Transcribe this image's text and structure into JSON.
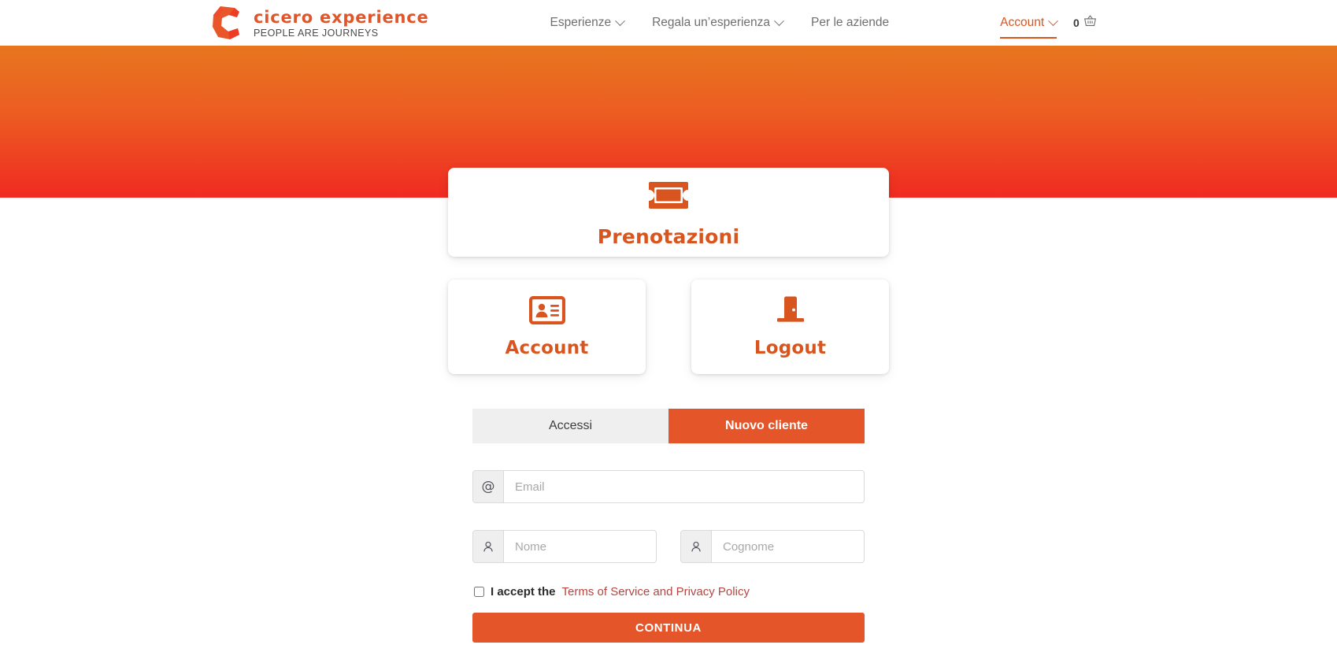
{
  "brand": {
    "logo_icon": "cicero-c-logo",
    "title": "cicero experience",
    "tagline": "PEOPLE ARE JOURNEYS",
    "accent_color": "#D9551F",
    "brand_red": "#F02A22",
    "brand_orange": "#E8761F"
  },
  "nav": {
    "items": [
      {
        "label": "Esperienze",
        "has_dropdown": true,
        "active": false
      },
      {
        "label": "Regala un’esperienza",
        "has_dropdown": true,
        "active": false
      },
      {
        "label": "Per le aziende",
        "has_dropdown": false,
        "active": false
      },
      {
        "label": "Account",
        "has_dropdown": true,
        "active": true
      }
    ],
    "cart": {
      "count": "0",
      "icon": "shopping-basket-icon"
    }
  },
  "panels": {
    "primary": {
      "label": "Prenotazioni",
      "icon": "ticket-icon"
    },
    "secondary": [
      {
        "label": "Account",
        "icon": "id-card-icon"
      },
      {
        "label": "Logout",
        "icon": "door-exit-icon"
      }
    ]
  },
  "auth": {
    "tabs": [
      {
        "label": "Accessi",
        "active": false
      },
      {
        "label": "Nuovo cliente",
        "active": true
      }
    ],
    "fields": {
      "email": {
        "placeholder": "Email",
        "value": "",
        "icon": "at-icon"
      },
      "first_name": {
        "placeholder": "Nome",
        "value": "",
        "icon": "user-icon"
      },
      "last_name": {
        "placeholder": "Cognome",
        "value": "",
        "icon": "user-icon"
      }
    },
    "terms": {
      "checked": false,
      "prefix": "I accept the",
      "link": "Terms of Service and Privacy Policy"
    },
    "submit_label": "CONTINUA"
  }
}
